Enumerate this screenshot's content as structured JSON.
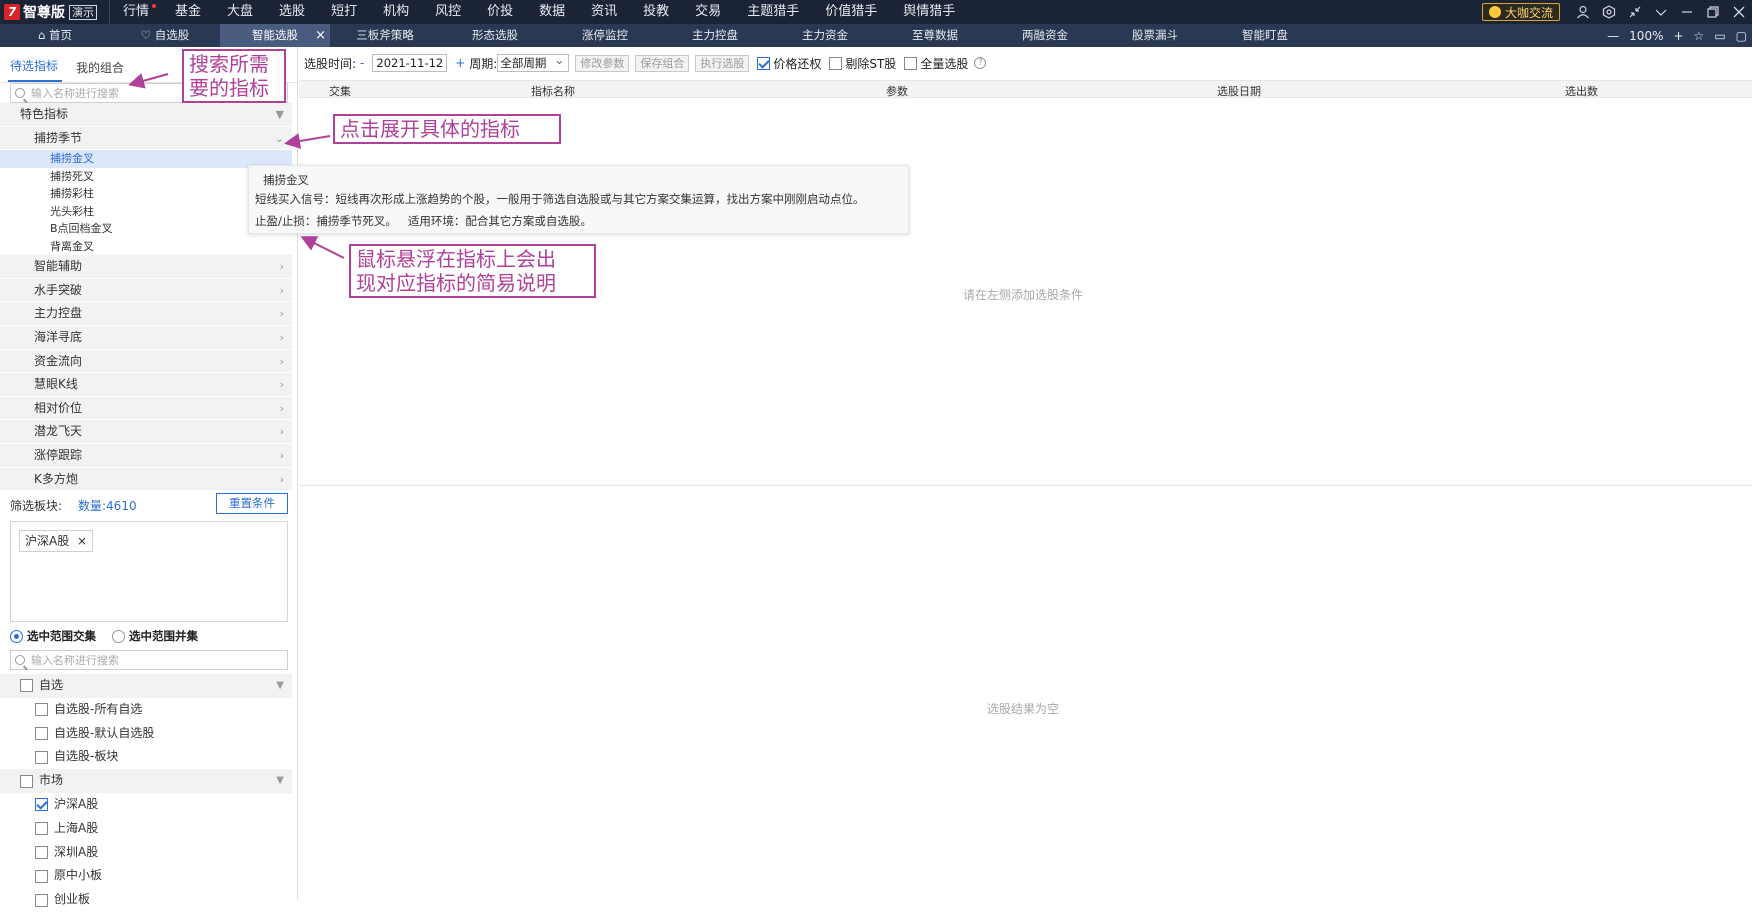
{
  "app": {
    "logo_text": "智尊版",
    "badge": "演示"
  },
  "menu": [
    "行情",
    "基金",
    "大盘",
    "选股",
    "短打",
    "机构",
    "风控",
    "价投",
    "数据",
    "资讯",
    "投教",
    "交易",
    "主题猎手",
    "价值猎手",
    "舆情猎手"
  ],
  "topright": {
    "bigshot_label": "大咖交流"
  },
  "tabs": [
    {
      "label": "首页",
      "icon": "home-icon"
    },
    {
      "label": "自选股",
      "icon": "heart-icon"
    },
    {
      "label": "智能选股",
      "active": true,
      "closable": true
    },
    {
      "label": "三板斧策略"
    },
    {
      "label": "形态选股"
    },
    {
      "label": "涨停监控"
    },
    {
      "label": "主力控盘"
    },
    {
      "label": "主力资金"
    },
    {
      "label": "至尊数据"
    },
    {
      "label": "两融资金"
    },
    {
      "label": "股票漏斗"
    },
    {
      "label": "智能盯盘"
    }
  ],
  "zoom": {
    "minus": "—",
    "level": "100%",
    "plus": "+"
  },
  "left": {
    "tab_candidates": "待选指标",
    "tab_combos": "我的组合",
    "search_placeholder": "输入名称进行搜索",
    "category_special": "特色指标",
    "subcategory": "捕捞季节",
    "indicators": [
      "捕捞金叉",
      "捕捞死叉",
      "捕捞彩柱",
      "光头彩柱",
      "B点回档金叉",
      "背离金叉"
    ],
    "categories": [
      "智能辅助",
      "水手突破",
      "主力控盘",
      "海洋寻底",
      "资金流向",
      "慧眼K线",
      "相对价位",
      "潜龙飞天",
      "涨停跟踪",
      "K多方炮"
    ],
    "filter_label": "筛选板块:",
    "filter_count": "数量:4610",
    "reset_button": "重置条件",
    "chip": "沪深A股",
    "chip_close": "×",
    "radio_intersect": "选中范围交集",
    "radio_union": "选中范围并集",
    "range_search_placeholder": "输入名称进行搜索",
    "group_watch": "自选",
    "watch_items": [
      "自选股-所有自选",
      "自选股-默认自选股",
      "自选股-板块"
    ],
    "group_market": "市场",
    "market_items": [
      {
        "label": "沪深A股",
        "checked": true
      },
      {
        "label": "上海A股",
        "checked": false
      },
      {
        "label": "深圳A股",
        "checked": false
      },
      {
        "label": "原中小板",
        "checked": false
      },
      {
        "label": "创业板",
        "checked": false
      }
    ]
  },
  "toolbar": {
    "date_label": "选股时间:",
    "minus": "-",
    "date_value": "2021-11-12",
    "plus": "+",
    "period_label": "周期:",
    "period_value": "全部周期",
    "edit_params": "修改参数",
    "save_combo": "保存组合",
    "run_select": "执行选股",
    "price_restore": "价格还权",
    "price_restore_checked": true,
    "exclude_st": "剔除ST股",
    "full_select": "全量选股",
    "help": "?"
  },
  "table": {
    "headers": [
      "交集",
      "指标名称",
      "参数",
      "选股日期",
      "选出数"
    ]
  },
  "empty_hint": "请在左侧添加选股条件",
  "empty_result": "选股结果为空",
  "tooltip": {
    "title": "捕捞金叉",
    "line1": "短线买入信号：短线再次形成上涨趋势的个股，一般用于筛选自选股或与其它方案交集运算，找出方案中刚刚启动点位。",
    "line2": "止盈/止损：捕捞季节死叉。   适用环境：配合其它方案或自选股。"
  },
  "annotations": {
    "search": "搜索所需\n要的指标",
    "expand": "点击展开具体的指标",
    "hover": "鼠标悬浮在指标上会出\n现对应指标的简易说明"
  },
  "colors": {
    "accent": "#2c6fd6",
    "annotation": "#b0419a",
    "topbar": "#1b2336",
    "tabbar": "#2b3853"
  }
}
